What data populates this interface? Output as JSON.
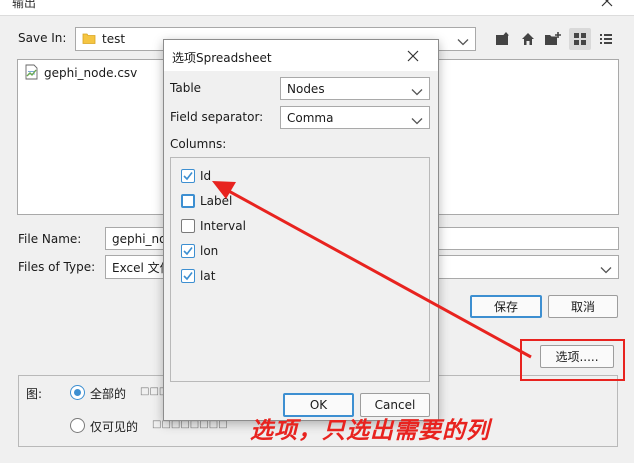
{
  "window": {
    "title": "输出"
  },
  "save_in": {
    "label": "Save In:",
    "value": "test"
  },
  "files": [
    {
      "name": "gephi_node.csv"
    }
  ],
  "file_name": {
    "label": "File Name:",
    "value": "gephi_no"
  },
  "files_of_type": {
    "label": "Files of Type:",
    "value": "Excel 文件"
  },
  "buttons": {
    "save": "保存",
    "cancel": "取消",
    "options": "选项....."
  },
  "graph": {
    "label": "图:",
    "options": [
      {
        "label": "全部的",
        "selected": true,
        "trail": "□□□"
      },
      {
        "label": "仅可见的",
        "selected": false,
        "trail": "□□□□□□□□"
      }
    ]
  },
  "dialog": {
    "title": "选项Spreadsheet",
    "table_label": "Table",
    "table_value": "Nodes",
    "separator_label": "Field separator:",
    "separator_value": "Comma",
    "columns_label": "Columns:",
    "columns": [
      {
        "name": "Id",
        "checked": true
      },
      {
        "name": "Label",
        "checked": false
      },
      {
        "name": "Interval",
        "checked": false
      },
      {
        "name": "lon",
        "checked": true
      },
      {
        "name": "lat",
        "checked": true
      }
    ],
    "ok": "OK",
    "cancel": "Cancel"
  },
  "annotation": {
    "text": "选项，只选出需要的列",
    "color": "#e8231f"
  },
  "colors": {
    "accent": "#3d8fd1",
    "annotation": "#e8231f",
    "folder": "#f5c542"
  }
}
